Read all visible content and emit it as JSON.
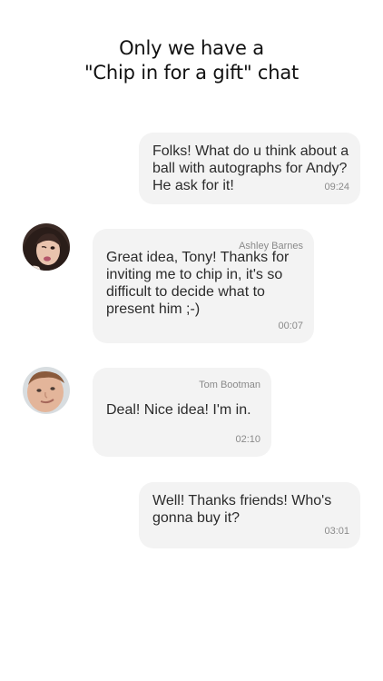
{
  "headline": {
    "line1": "Only we have a",
    "line2": "\"Chip in for a gift\" chat"
  },
  "messages": [
    {
      "direction": "outgoing",
      "text": "Folks! What do u think about a ball with autographs for Andy? He ask for it!",
      "time": "09:24"
    },
    {
      "direction": "incoming",
      "sender": "Ashley Barnes",
      "text": "Great idea, Tony! Thanks for inviting me to chip in, it's so difficult to decide what to present him ;-)",
      "time": "00:07"
    },
    {
      "direction": "incoming",
      "sender": "Tom Bootman",
      "text": "Deal! Nice idea! I'm in.",
      "time": "02:10"
    },
    {
      "direction": "outgoing",
      "text": "Well! Thanks friends! Who's gonna buy it?",
      "time": "03:01"
    }
  ],
  "colors": {
    "bubble": "#f3f3f3",
    "meta_text": "#8a8a8a"
  }
}
